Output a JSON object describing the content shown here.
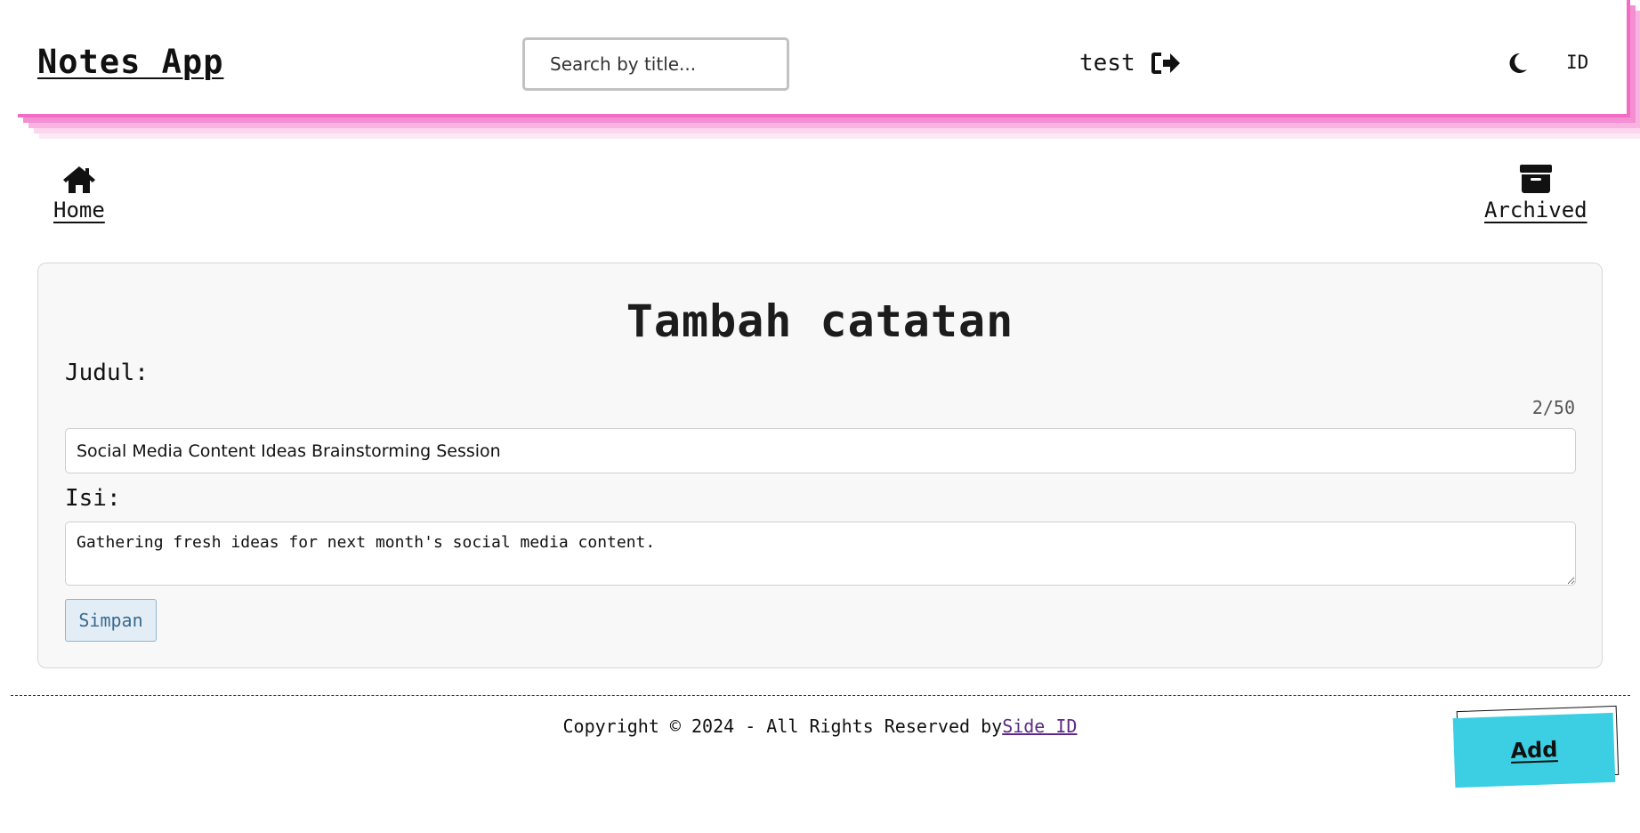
{
  "header": {
    "brand": "Notes App",
    "search_placeholder": "Search by title...",
    "user_name": "test",
    "lang_label": "ID",
    "logout_icon": "sign-out-icon",
    "theme_icon": "moon-icon"
  },
  "nav": {
    "home": {
      "label": "Home",
      "icon": "home-icon"
    },
    "archived": {
      "label": "Archived",
      "icon": "archive-box-icon"
    }
  },
  "form": {
    "title": "Tambah catatan",
    "title_label": "Judul:",
    "char_counter": "2/50",
    "title_value": "Social Media Content Ideas Brainstorming Session",
    "body_label": "Isi:",
    "body_value": "Gathering fresh ideas for next month's social media content.",
    "save_label": "Simpan"
  },
  "footer": {
    "copyright_text": "Copyright © 2024 - All Rights Reserved by",
    "author_link": "Side ID"
  },
  "fab": {
    "add_label": "Add"
  },
  "colors": {
    "header_accent": "#f26cc4",
    "add_button": "#3ccfe3",
    "save_button_bg": "#e3edf6",
    "link": "#5b2a86"
  }
}
